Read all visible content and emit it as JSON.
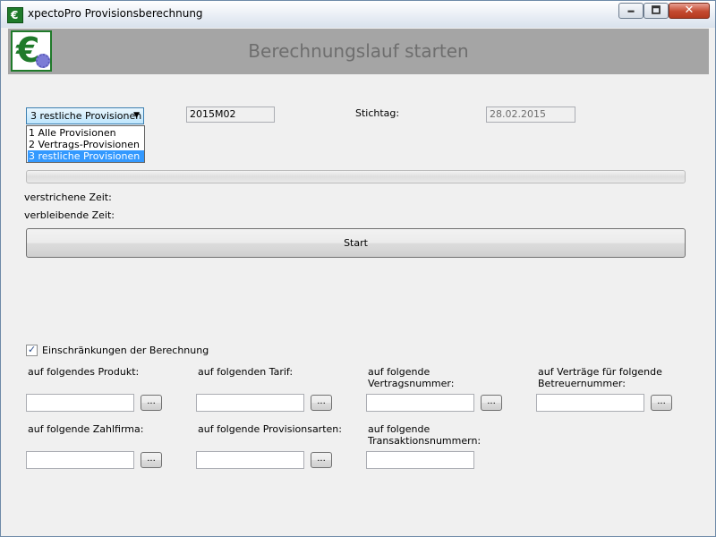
{
  "window": {
    "title": "xpectoPro Provisionsberechnung",
    "icon": "euro-app-icon",
    "controls": {
      "minimize": "🗕",
      "maximize": "🗖",
      "close": "✕"
    }
  },
  "header": {
    "title": "Berechnungslauf starten",
    "logo": "euro-gear-logo"
  },
  "selection": {
    "combo_value": "3 restliche Provisionen",
    "options": [
      "1 Alle Provisionen",
      "2 Vertrags-Provisionen",
      "3 restliche Provisionen"
    ],
    "selected_index": 2
  },
  "period": {
    "value": "2015M02"
  },
  "stichtag": {
    "label": "Stichtag:",
    "value": "28.02.2015"
  },
  "progress": {
    "fraction": 0.0
  },
  "timing": {
    "elapsed_label": "verstrichene Zeit:",
    "remaining_label": "verbleibende Zeit:"
  },
  "start_label": "Start",
  "restrictions": {
    "checkbox_label": "Einschränkungen der Berechnung",
    "checked": true,
    "produkt": "auf folgendes Produkt:",
    "tarif": "auf folgenden Tarif:",
    "vertrag_l1": "auf folgende",
    "vertrag_l2": "Vertragsnummer:",
    "betreuer_l1": "auf Verträge für folgende",
    "betreuer_l2": "Betreuernummer:",
    "zahlfirma": "auf folgende Zahlfirma:",
    "provisionsarten": "auf folgende Provisionsarten:",
    "transaktion_l1": "auf folgende",
    "transaktion_l2": "Transaktionsnummern:",
    "browse_label": "..."
  },
  "colors": {
    "header_bg": "#a5a5a5",
    "brand_green": "#1f7a2a",
    "selection_blue": "#3399ff"
  }
}
